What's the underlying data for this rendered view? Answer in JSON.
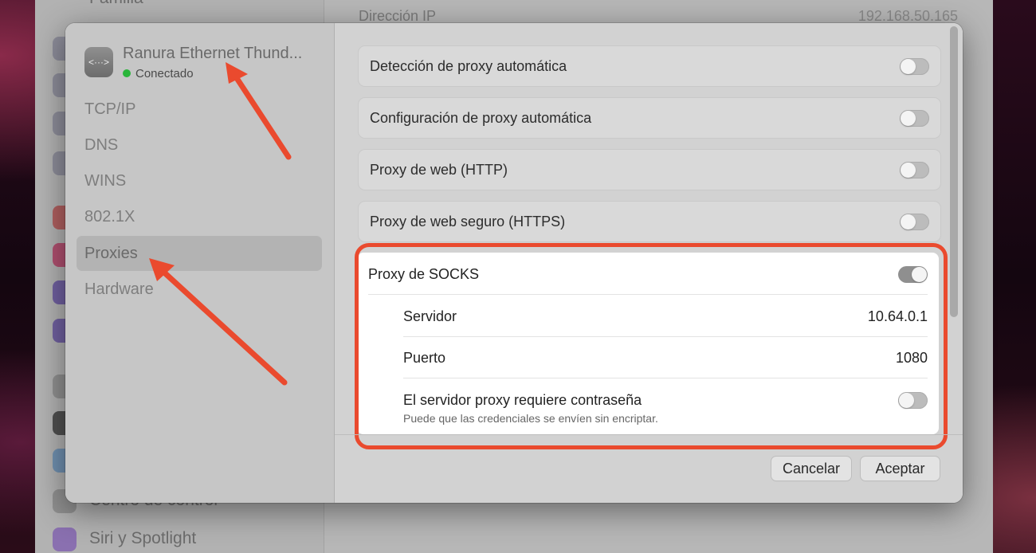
{
  "background": {
    "sidebar_visible": [
      "Familia",
      "Centro de control",
      "Siri y Spotlight"
    ],
    "main_label": "Dirección IP",
    "main_value": "192.168.50.165"
  },
  "interface": {
    "name": "Ranura Ethernet Thund...",
    "status": "Conectado",
    "icon": "ethernet-dots-icon",
    "status_color": "#29b53a"
  },
  "nav": [
    "TCP/IP",
    "DNS",
    "WINS",
    "802.1X",
    "Proxies",
    "Hardware"
  ],
  "nav_selected": "Proxies",
  "proxy_rows": [
    {
      "label": "Detección de proxy automática",
      "enabled": false
    },
    {
      "label": "Configuración de proxy automática",
      "enabled": false
    },
    {
      "label": "Proxy de web (HTTP)",
      "enabled": false
    },
    {
      "label": "Proxy de web seguro (HTTPS)",
      "enabled": false
    }
  ],
  "socks": {
    "label": "Proxy de SOCKS",
    "enabled": true,
    "server_label": "Servidor",
    "server_value": "10.64.0.1",
    "port_label": "Puerto",
    "port_value": "1080",
    "password_label": "El servidor proxy requiere contraseña",
    "password_enabled": false,
    "password_note": "Puede que las credenciales se envíen sin encriptar."
  },
  "buttons": {
    "cancel": "Cancelar",
    "accept": "Aceptar"
  },
  "colors": {
    "highlight": "#ea4a2e",
    "arrows": "#ea4a2e"
  }
}
